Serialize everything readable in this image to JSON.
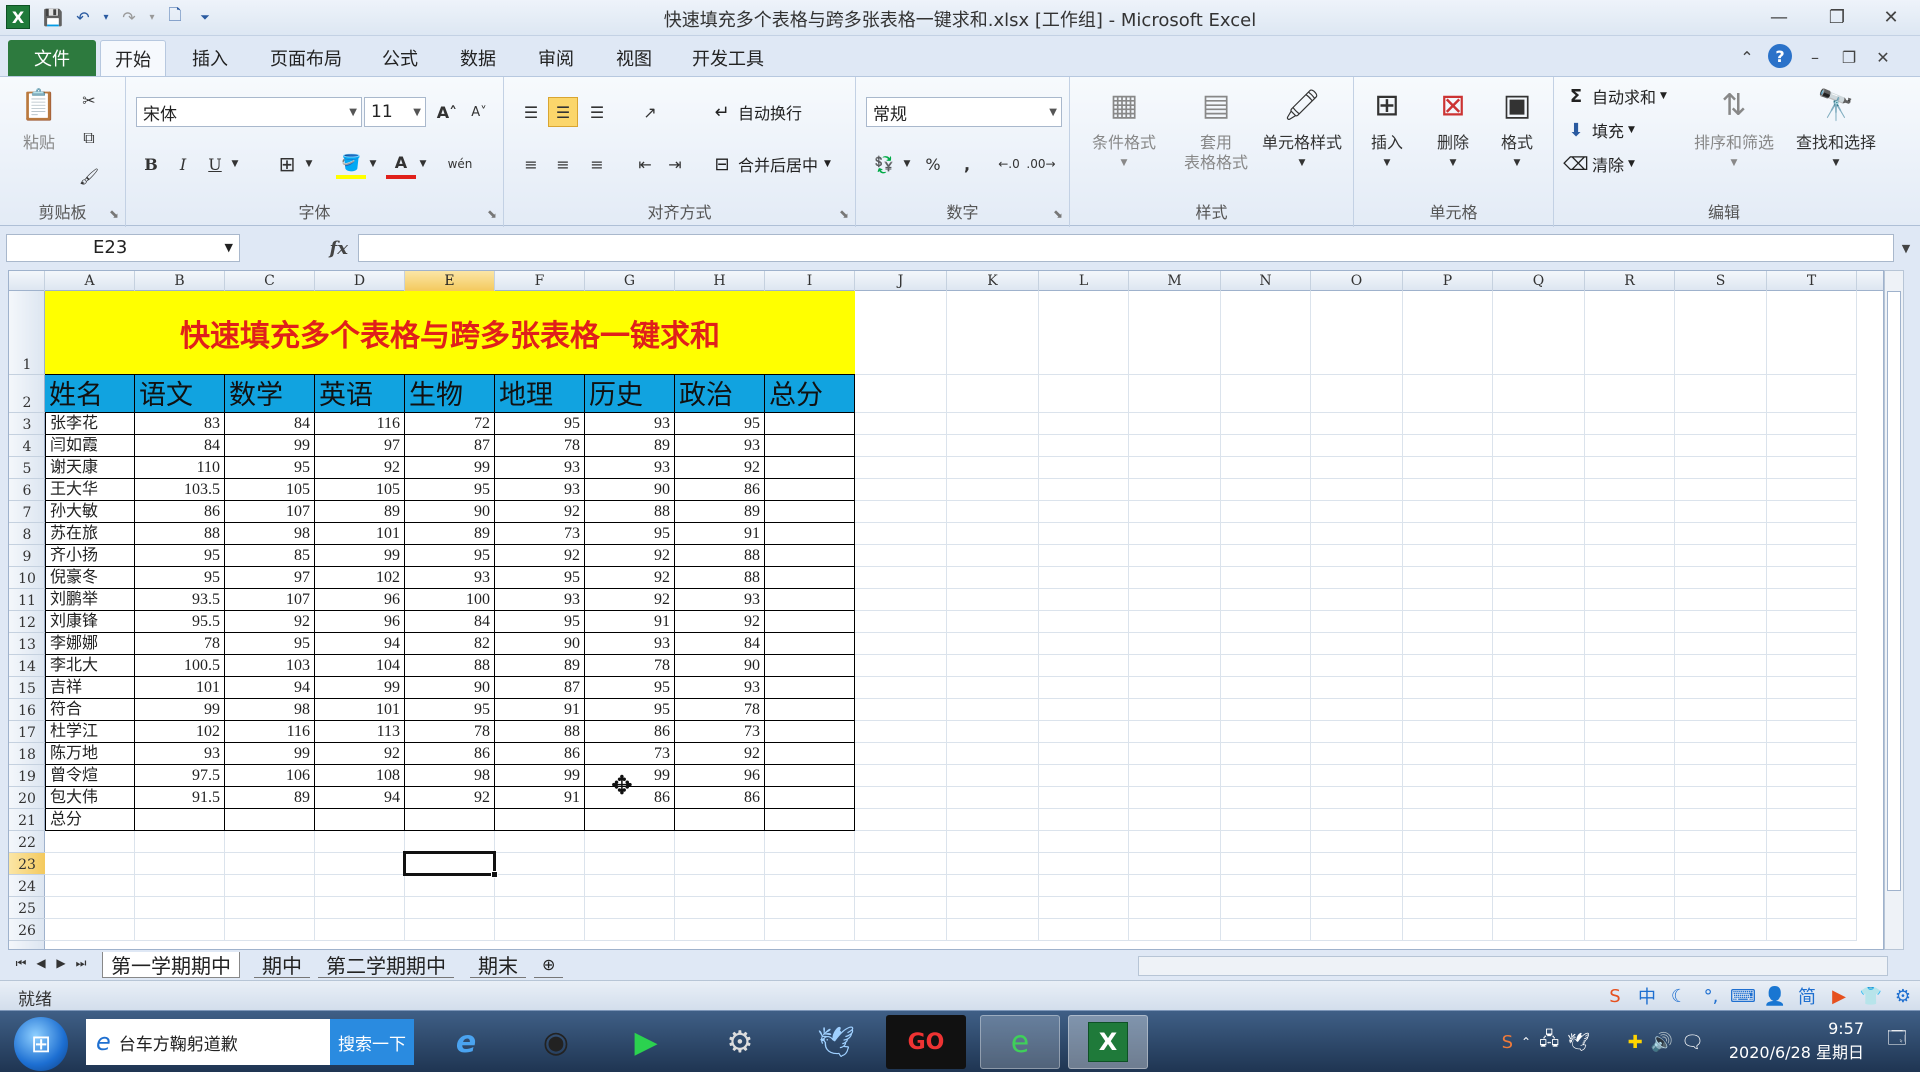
{
  "window": {
    "title": "快速填充多个表格与跨多张表格一键求和.xlsx  [工作组] - Microsoft Excel",
    "app_icon": "X"
  },
  "ribbon_tabs": [
    "文件",
    "开始",
    "插入",
    "页面布局",
    "公式",
    "数据",
    "审阅",
    "视图",
    "开发工具"
  ],
  "active_tab": "开始",
  "ribbon": {
    "clipboard": {
      "label": "剪贴板",
      "paste": "粘贴"
    },
    "font": {
      "label": "字体",
      "name": "宋体",
      "size": "11",
      "bold": "B",
      "italic": "I",
      "underline": "U",
      "grow": "A˄",
      "shrink": "A˅",
      "wen": "wén"
    },
    "alignment": {
      "label": "对齐方式",
      "wrap": "自动换行",
      "merge": "合并后居中"
    },
    "number": {
      "label": "数字",
      "format": "常规",
      "percent": "%",
      "comma": ","
    },
    "styles": {
      "label": "样式",
      "conditional": "条件格式",
      "as_table_1": "套用",
      "as_table_2": "表格格式",
      "cell_styles": "单元格样式"
    },
    "cells": {
      "label": "单元格",
      "insert": "插入",
      "delete": "删除",
      "format": "格式"
    },
    "editing": {
      "label": "编辑",
      "autosum": "自动求和",
      "fill": "填充",
      "clear": "清除",
      "sort": "排序和筛选",
      "find": "查找和选择"
    }
  },
  "formula_bar": {
    "name_box": "E23",
    "fx": "fx",
    "formula": ""
  },
  "grid": {
    "columns": [
      "A",
      "B",
      "C",
      "D",
      "E",
      "F",
      "G",
      "H",
      "I",
      "J",
      "K",
      "L",
      "M",
      "N",
      "O",
      "P",
      "Q",
      "R",
      "S",
      "T"
    ],
    "selected_column": "E",
    "rows": [
      "1",
      "2",
      "3",
      "4",
      "5",
      "6",
      "7",
      "8",
      "9",
      "10",
      "11",
      "12",
      "13",
      "14",
      "15",
      "16",
      "17",
      "18",
      "19",
      "20",
      "21",
      "22",
      "23",
      "24",
      "25",
      "26"
    ],
    "selected_row": "23",
    "title": "快速填充多个表格与跨多张表格一键求和",
    "headers": [
      "姓名",
      "语文",
      "数学",
      "英语",
      "生物",
      "地理",
      "历史",
      "政治",
      "总分"
    ],
    "data": [
      [
        "张李花",
        "83",
        "84",
        "116",
        "72",
        "95",
        "93",
        "95",
        ""
      ],
      [
        "闫如霞",
        "84",
        "99",
        "97",
        "87",
        "78",
        "89",
        "93",
        ""
      ],
      [
        "谢天康",
        "110",
        "95",
        "92",
        "99",
        "93",
        "93",
        "92",
        ""
      ],
      [
        "王大华",
        "103.5",
        "105",
        "105",
        "95",
        "93",
        "90",
        "86",
        ""
      ],
      [
        "孙大敏",
        "86",
        "107",
        "89",
        "90",
        "92",
        "88",
        "89",
        ""
      ],
      [
        "苏在旅",
        "88",
        "98",
        "101",
        "89",
        "73",
        "95",
        "91",
        ""
      ],
      [
        "齐小扬",
        "95",
        "85",
        "99",
        "95",
        "92",
        "92",
        "88",
        ""
      ],
      [
        "倪豪冬",
        "95",
        "97",
        "102",
        "93",
        "95",
        "92",
        "88",
        ""
      ],
      [
        "刘鹏举",
        "93.5",
        "107",
        "96",
        "100",
        "93",
        "92",
        "93",
        ""
      ],
      [
        "刘康锋",
        "95.5",
        "92",
        "96",
        "84",
        "95",
        "91",
        "92",
        ""
      ],
      [
        "李娜娜",
        "78",
        "95",
        "94",
        "82",
        "90",
        "93",
        "84",
        ""
      ],
      [
        "李北大",
        "100.5",
        "103",
        "104",
        "88",
        "89",
        "78",
        "90",
        ""
      ],
      [
        "吉祥",
        "101",
        "94",
        "99",
        "90",
        "87",
        "95",
        "93",
        ""
      ],
      [
        "符合",
        "99",
        "98",
        "101",
        "95",
        "91",
        "95",
        "78",
        ""
      ],
      [
        "杜学江",
        "102",
        "116",
        "113",
        "78",
        "88",
        "86",
        "73",
        ""
      ],
      [
        "陈万地",
        "93",
        "99",
        "92",
        "86",
        "86",
        "73",
        "92",
        ""
      ],
      [
        "曾令煊",
        "97.5",
        "106",
        "108",
        "98",
        "99",
        "99",
        "96",
        ""
      ],
      [
        "包大伟",
        "91.5",
        "89",
        "94",
        "92",
        "91",
        "86",
        "86",
        ""
      ],
      [
        "总分",
        "",
        "",
        "",
        "",
        "",
        "",
        "",
        ""
      ]
    ],
    "colors": {
      "title_bg": "#ffff00",
      "title_fg": "#e0201b",
      "header_bg": "#11a3e0"
    }
  },
  "sheet_tabs": [
    "第一学期期中",
    "期中",
    "第二学期期中",
    "期末"
  ],
  "active_sheet": "第一学期期中",
  "status": {
    "ready": "就绪"
  },
  "ime_bar": {
    "lang": "中",
    "simplified": "简"
  },
  "taskbar": {
    "search_text": "台车方鞠躬道歉",
    "search_button": "搜索一下",
    "time": "9:57",
    "date": "2020/6/28 星期日"
  }
}
